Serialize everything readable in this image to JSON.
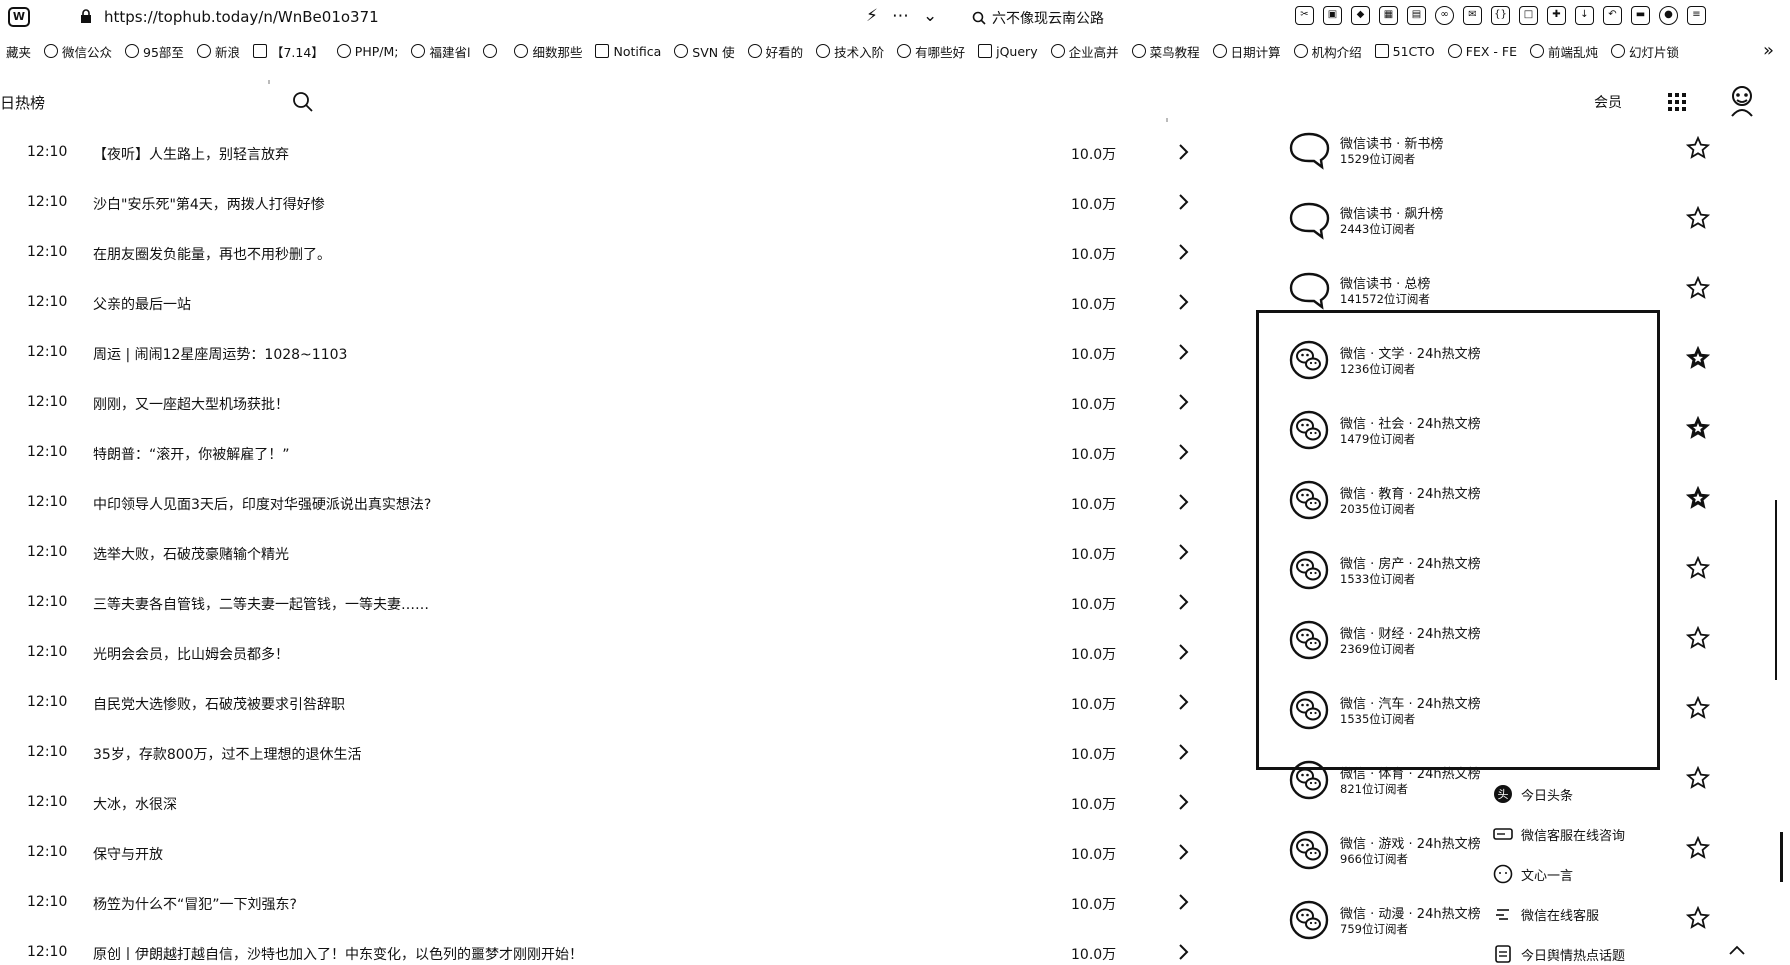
{
  "browser": {
    "url": "https://tophub.today/n/WnBe01o371",
    "search_suggestion": "六不像现云南公路",
    "bookmarks": [
      "藏夹",
      "微信公众",
      "95部至",
      "新浪",
      "【7.14】",
      "PHP/M;",
      "福建省l",
      "",
      "细数那些",
      "Notifica",
      "SVN 使",
      "好看的",
      "技术入阶",
      "有哪些好",
      "jQuery",
      "企业高并",
      "菜鸟教程",
      "日期计算",
      "机构介绍",
      "51CTO",
      "FEX - FE",
      "前端乱炖",
      "幻灯片锁"
    ]
  },
  "site": {
    "title": "日热榜",
    "member_label": "会员"
  },
  "news": [
    {
      "time": "12:10",
      "title": "【夜听】人生路上，别轻言放弃",
      "count": "10.0万"
    },
    {
      "time": "12:10",
      "title": "沙白\"安乐死\"第4天，两拨人打得好惨",
      "count": "10.0万"
    },
    {
      "time": "12:10",
      "title": "在朋友圈发负能量，再也不用秒删了。",
      "count": "10.0万"
    },
    {
      "time": "12:10",
      "title": "父亲的最后一站",
      "count": "10.0万"
    },
    {
      "time": "12:10",
      "title": "周运 | 闹闹12星座周运势：1028~1103",
      "count": "10.0万"
    },
    {
      "time": "12:10",
      "title": "刚刚，又一座超大型机场获批！",
      "count": "10.0万"
    },
    {
      "time": "12:10",
      "title": "特朗普：“滚开，你被解雇了！”",
      "count": "10.0万"
    },
    {
      "time": "12:10",
      "title": "中印领导人见面3天后，印度对华强硬派说出真实想法?",
      "count": "10.0万"
    },
    {
      "time": "12:10",
      "title": "选举大败，石破茂豪赌输个精光",
      "count": "10.0万"
    },
    {
      "time": "12:10",
      "title": "三等夫妻各自管钱，二等夫妻一起管钱，一等夫妻……",
      "count": "10.0万"
    },
    {
      "time": "12:10",
      "title": "光明会会员，比山姆会员都多！",
      "count": "10.0万"
    },
    {
      "time": "12:10",
      "title": "自民党大选惨败，石破茂被要求引咎辞职",
      "count": "10.0万"
    },
    {
      "time": "12:10",
      "title": "35岁，存款800万，过不上理想的退休生活",
      "count": "10.0万"
    },
    {
      "time": "12:10",
      "title": "大冰，水很深",
      "count": "10.0万"
    },
    {
      "time": "12:10",
      "title": "保守与开放",
      "count": "10.0万"
    },
    {
      "time": "12:10",
      "title": "杨笠为什么不“冒犯”一下刘强东?",
      "count": "10.0万"
    },
    {
      "time": "12:10",
      "title": "原创丨伊朗越打越自信，沙特也加入了！中东变化，以色列的噩梦才刚刚开始！",
      "count": "10.0万"
    }
  ],
  "boards": [
    {
      "name": "微信读书 · 新书榜",
      "subs": "1529位订阅者",
      "icon": "chat-bubble-icon",
      "starred": false
    },
    {
      "name": "微信读书 · 飙升榜",
      "subs": "2443位订阅者",
      "icon": "chat-bubble-icon",
      "starred": false
    },
    {
      "name": "微信读书 · 总榜",
      "subs": "141572位订阅者",
      "icon": "chat-bubble-icon",
      "starred": false
    },
    {
      "name": "微信 · 文学 · 24h热文榜",
      "subs": "1236位订阅者",
      "icon": "wechat-icon",
      "starred": true
    },
    {
      "name": "微信 · 社会 · 24h热文榜",
      "subs": "1479位订阅者",
      "icon": "wechat-icon",
      "starred": true
    },
    {
      "name": "微信 · 教育 · 24h热文榜",
      "subs": "2035位订阅者",
      "icon": "wechat-icon",
      "starred": true
    },
    {
      "name": "微信 · 房产 · 24h热文榜",
      "subs": "1533位订阅者",
      "icon": "wechat-icon",
      "starred": false
    },
    {
      "name": "微信 · 财经 · 24h热文榜",
      "subs": "2369位订阅者",
      "icon": "wechat-icon",
      "starred": false
    },
    {
      "name": "微信 · 汽车 · 24h热文榜",
      "subs": "1535位订阅者",
      "icon": "wechat-icon",
      "starred": false
    },
    {
      "name": "微信 · 体育 · 24h热文榜",
      "subs": "821位订阅者",
      "icon": "wechat-icon",
      "starred": false
    },
    {
      "name": "微信 · 游戏 · 24h热文榜",
      "subs": "966位订阅者",
      "icon": "wechat-icon",
      "starred": false
    },
    {
      "name": "微信 · 动漫 · 24h热文榜",
      "subs": "759位订阅者",
      "icon": "wechat-icon",
      "starred": false
    }
  ],
  "popup": [
    {
      "label": "今日头条",
      "icon": "toutiao-icon"
    },
    {
      "label": "微信客服在线咨询",
      "icon": "keyboard-icon"
    },
    {
      "label": "文心一言",
      "icon": "wenxin-icon"
    },
    {
      "label": "微信在线客服",
      "icon": "service-icon"
    },
    {
      "label": "今日舆情热点话题",
      "icon": "topic-icon"
    }
  ]
}
